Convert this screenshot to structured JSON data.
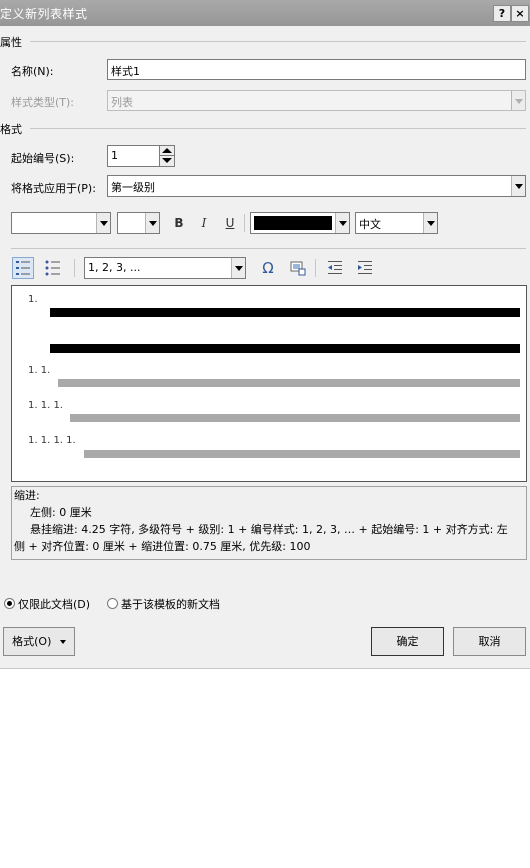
{
  "window": {
    "title": "定义新列表样式",
    "help": "?",
    "close": "×"
  },
  "properties": {
    "heading": "属性",
    "name_label": "名称(N):",
    "name_value": "样式1",
    "style_type_label": "样式类型(T):",
    "style_type_value": "列表"
  },
  "format": {
    "heading": "格式",
    "start_label": "起始编号(S):",
    "start_value": "1",
    "apply_label": "将格式应用于(P):",
    "apply_value": "第一级别",
    "font_value": "",
    "size_value": "",
    "bold": "B",
    "italic": "I",
    "underline": "U",
    "color": "#000000",
    "language_value": "中文",
    "numbering_value": "1, 2, 3, ...",
    "symbol_glyph": "Ω"
  },
  "preview": {
    "levels": [
      "1.",
      "1. 1.",
      "1. 1. 1.",
      "1. 1. 1. 1."
    ]
  },
  "description": {
    "line1": "缩进:",
    "line2": "左侧:  0 厘米",
    "line3": "悬挂缩进: 4.25 字符, 多级符号 + 级别: 1 + 编号样式: 1, 2, 3, … + 起始编号: 1 + 对齐方式: 左",
    "line4": "侧 + 对齐位置:  0 厘米 + 缩进位置:  0.75 厘米, 优先级: 100"
  },
  "scope": {
    "this_doc": "仅限此文档(D)",
    "template": "基于该模板的新文档",
    "selected": "this_doc"
  },
  "buttons": {
    "format": "格式(O)",
    "ok": "确定",
    "cancel": "取消"
  }
}
